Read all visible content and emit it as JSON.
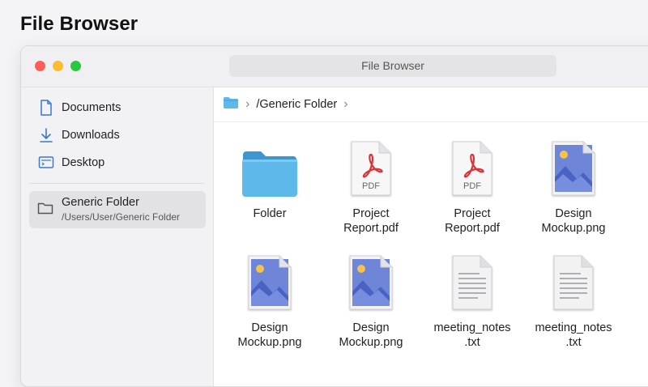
{
  "page": {
    "title": "File Browser"
  },
  "window": {
    "title": "File Browser"
  },
  "sidebar": {
    "items": [
      {
        "label": "Documents",
        "icon": "document-icon"
      },
      {
        "label": "Downloads",
        "icon": "download-icon"
      },
      {
        "label": "Desktop",
        "icon": "desktop-icon"
      }
    ],
    "selected": {
      "label": "Generic Folder",
      "path": "/Users/User/Generic Folder",
      "icon": "folder-outline-icon"
    }
  },
  "pathbar": {
    "crumb": "/Generic Folder"
  },
  "files": [
    {
      "kind": "folder",
      "line1": "Folder",
      "line2": ""
    },
    {
      "kind": "pdf",
      "line1": "Project",
      "line2": "Report.pdf",
      "badge": "PDF"
    },
    {
      "kind": "pdf",
      "line1": "Project",
      "line2": "Report.pdf",
      "badge": "PDF"
    },
    {
      "kind": "image",
      "line1": "Design",
      "line2": "Mockup.png"
    },
    {
      "kind": "image",
      "line1": "Design",
      "line2": "Mockup.png"
    },
    {
      "kind": "image",
      "line1": "Design",
      "line2": "Mockup.png"
    },
    {
      "kind": "text",
      "line1": "meeting_notes",
      "line2": ".txt"
    },
    {
      "kind": "text",
      "line1": "meeting_notes",
      "line2": ".txt"
    }
  ],
  "colors": {
    "accent": "#4f9fe0",
    "pdf_red": "#d8333a",
    "folder_blue": "#5fb8ea"
  }
}
